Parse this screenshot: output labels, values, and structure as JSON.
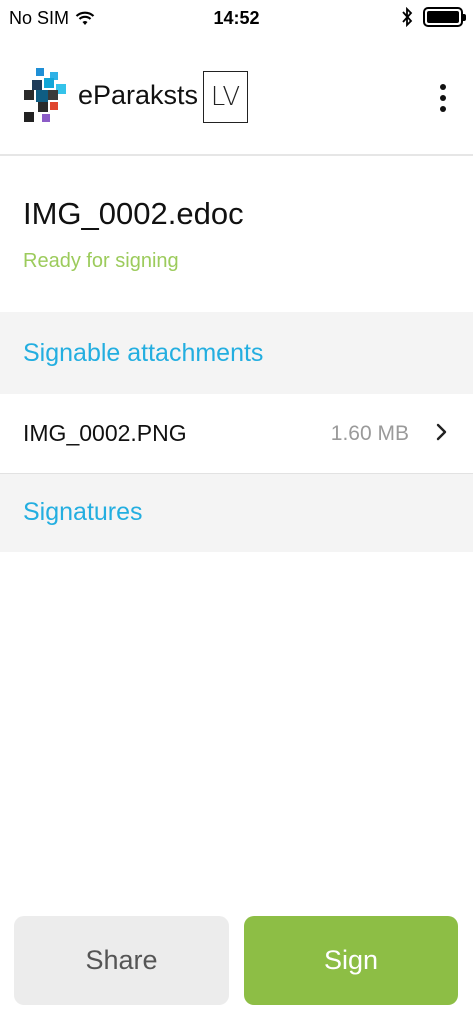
{
  "status_bar": {
    "carrier": "No SIM",
    "time": "14:52",
    "icons": [
      "wifi-icon",
      "bluetooth-icon",
      "battery-icon"
    ]
  },
  "header": {
    "brand": "eParaksts",
    "country_badge": "LV",
    "menu_icon": "more-vertical-icon"
  },
  "document": {
    "title": "IMG_0002.edoc",
    "status": "Ready for signing"
  },
  "attachments_section": {
    "label": "Signable attachments",
    "items": [
      {
        "name": "IMG_0002.PNG",
        "size": "1.60 MB"
      }
    ]
  },
  "signatures_section": {
    "label": "Signatures"
  },
  "actions": {
    "share_label": "Share",
    "sign_label": "Sign"
  },
  "colors": {
    "accent_blue": "#23aee0",
    "status_green": "#9ccb5c",
    "sign_green": "#8dbe45",
    "section_bg": "#f4f4f4"
  }
}
